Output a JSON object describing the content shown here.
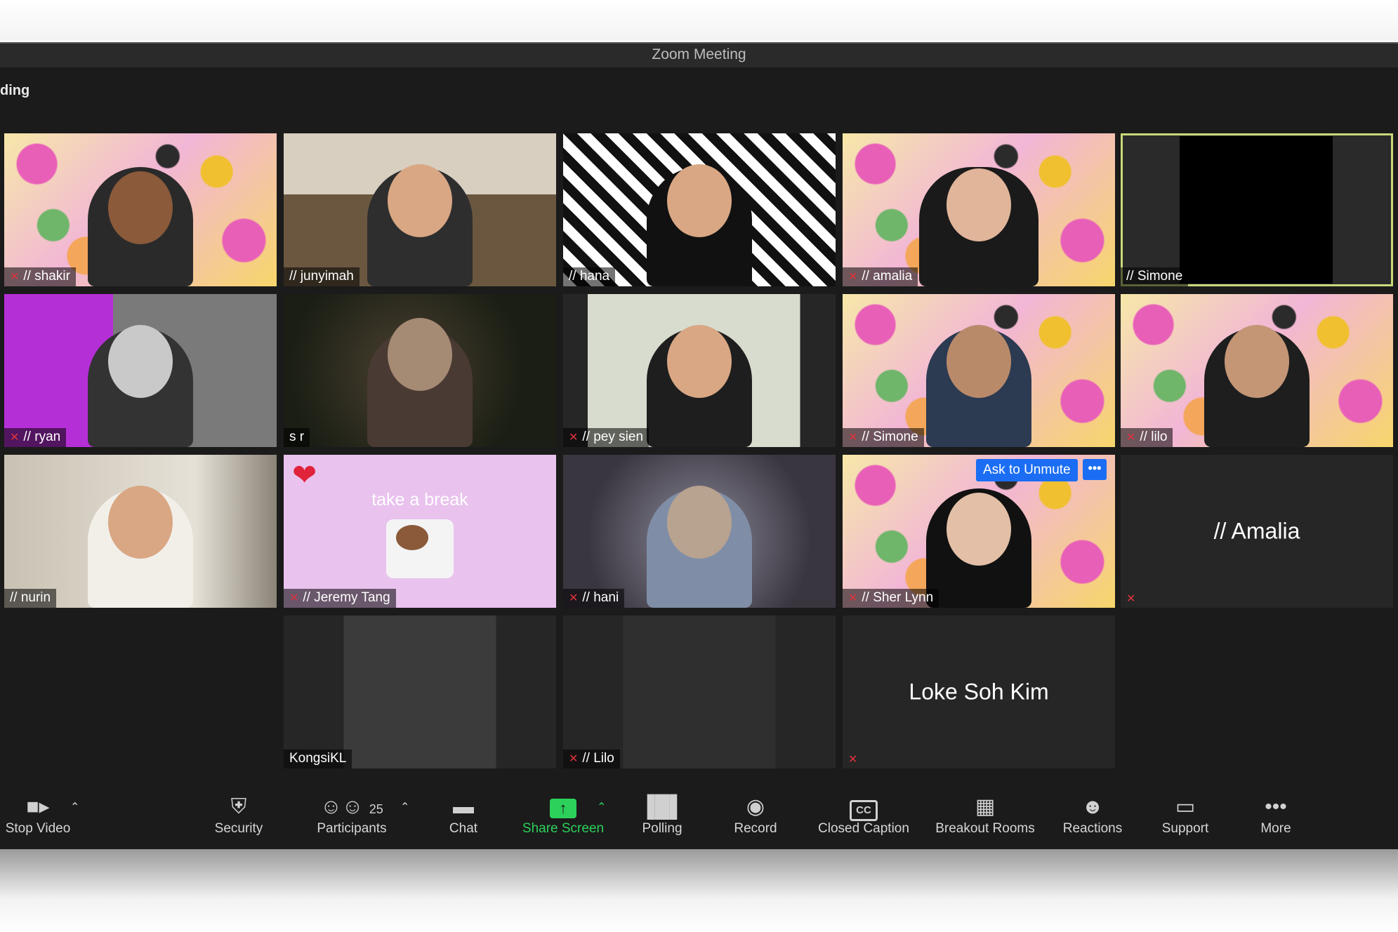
{
  "window": {
    "title": "Zoom Meeting",
    "recording_label": "ding"
  },
  "tiles": [
    {
      "name": "// shakir",
      "muted": true
    },
    {
      "name": "// junyimah",
      "muted": false
    },
    {
      "name": "// hana",
      "muted": false
    },
    {
      "name": "// amalia",
      "muted": true
    },
    {
      "name": "// Simone",
      "muted": false
    },
    {
      "name": "// ryan",
      "muted": true
    },
    {
      "name": "s r",
      "muted": false
    },
    {
      "name": "// pey sien",
      "muted": true
    },
    {
      "name": "// Simone",
      "muted": true
    },
    {
      "name": "// lilo",
      "muted": true
    },
    {
      "name": "// nurin",
      "muted": false
    },
    {
      "name": "// Jeremy Tang",
      "muted": true,
      "overlay_text": "take a break"
    },
    {
      "name": "// hani",
      "muted": true
    },
    {
      "name": "// Sher Lynn",
      "muted": true
    },
    {
      "name": "// Amalia",
      "muted": true
    },
    {
      "name": "KongsiKL",
      "muted": false
    },
    {
      "name": "// Lilo",
      "muted": true
    },
    {
      "name": "Loke Soh Kim",
      "muted": true
    }
  ],
  "hover_controls": {
    "ask_to_unmute": "Ask to Unmute",
    "more": "•••"
  },
  "toolbar": {
    "stop_video": "Stop Video",
    "security": "Security",
    "participants": "Participants",
    "participants_count": "25",
    "chat": "Chat",
    "share_screen": "Share Screen",
    "polling": "Polling",
    "record": "Record",
    "closed_caption": "Closed Caption",
    "breakout_rooms": "Breakout Rooms",
    "reactions": "Reactions",
    "support": "Support",
    "more": "More",
    "cc_glyph": "CC",
    "caret": "⌃"
  },
  "icons": {
    "mic_off": "mic-off-icon",
    "video": "video-camera-icon",
    "security": "shield-icon",
    "participants": "people-icon",
    "chat": "chat-bubble-icon",
    "share": "share-arrow-icon",
    "polling": "bar-chart-icon",
    "record": "record-icon",
    "cc": "cc-icon",
    "breakout": "grid-icon",
    "reactions": "smiley-icon",
    "support": "cast-icon",
    "more": "ellipsis-icon"
  },
  "colors": {
    "accent_green": "#2bd15a",
    "muted_red": "#e0323c",
    "unmute_blue": "#1b6ef3",
    "active_border": "#c8d97a"
  }
}
